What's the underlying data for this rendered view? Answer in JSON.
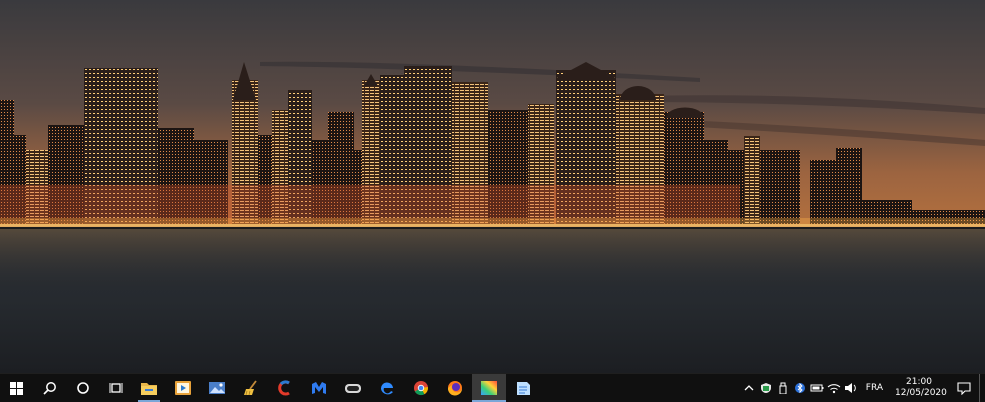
{
  "desktop": {
    "wallpaper": "night-city-skyline-waterfront",
    "colors": {
      "sky_top": "#3c3a3e",
      "sky_horizon": "#a86a40",
      "water": "#26292d",
      "lights": "#ffb347"
    }
  },
  "taskbar": {
    "background": "#101010",
    "system_buttons": [
      {
        "name": "start-button",
        "icon": "windows-logo-icon"
      },
      {
        "name": "search-button",
        "icon": "search-icon"
      },
      {
        "name": "cortana-button",
        "icon": "cortana-circle-icon"
      },
      {
        "name": "task-view-button",
        "icon": "task-view-icon"
      }
    ],
    "apps": [
      {
        "name": "file-explorer",
        "icon": "folder-icon",
        "open": true
      },
      {
        "name": "media-player",
        "icon": "media-player-icon",
        "open": false
      },
      {
        "name": "photo-viewer",
        "icon": "photo-icon",
        "open": false
      },
      {
        "name": "cleaner",
        "icon": "broom-icon",
        "open": false
      },
      {
        "name": "ccleaner",
        "icon": "ccleaner-icon",
        "open": false
      },
      {
        "name": "malwarebytes",
        "icon": "malwarebytes-icon",
        "open": false
      },
      {
        "name": "vr-headset-app",
        "icon": "headset-icon",
        "open": false
      },
      {
        "name": "edge",
        "icon": "edge-icon",
        "open": false
      },
      {
        "name": "chrome",
        "icon": "chrome-icon",
        "open": false
      },
      {
        "name": "firefox",
        "icon": "firefox-icon",
        "open": false
      },
      {
        "name": "paint-app",
        "icon": "color-grid-icon",
        "open": true,
        "active": true
      },
      {
        "name": "notepad-app",
        "icon": "notepad-icon",
        "open": false
      }
    ],
    "tray": {
      "icons": [
        "chevron-up-icon",
        "security-icon",
        "usb-icon",
        "bluetooth-icon",
        "battery-icon",
        "wifi-icon",
        "volume-icon"
      ],
      "language": "FRA",
      "time": "21:00",
      "date": "12/05/2020"
    }
  }
}
